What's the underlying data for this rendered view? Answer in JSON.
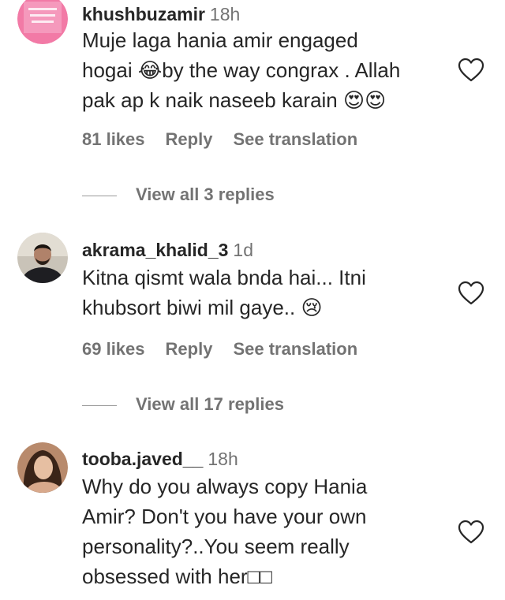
{
  "comments": [
    {
      "username": "khushbuzamir",
      "time": "18h",
      "lines": [
        "Muje laga hania amir engaged",
        "hogai 😂by the way congrax . Allah",
        "pak ap k naik naseeb karain 😍😍"
      ],
      "likes": "81 likes",
      "reply_label": "Reply",
      "translate_label": "See translation",
      "view_replies": "View all 3 replies",
      "avatar": "pink-avatar"
    },
    {
      "username": "akrama_khalid_3",
      "time": "1d",
      "lines": [
        "Kitna qismt wala bnda hai... Itni",
        "khubsort biwi mil gaye.. 😢"
      ],
      "likes": "69 likes",
      "reply_label": "Reply",
      "translate_label": "See translation",
      "view_replies": "View all 17 replies",
      "avatar": "man-avatar"
    },
    {
      "username": "tooba.javed__",
      "time": "18h",
      "lines": [
        "Why do you always copy Hania",
        "Amir? Don't you have your own",
        "personality?..You seem really",
        "obsessed with her□□"
      ],
      "avatar": "woman-avatar"
    }
  ],
  "icons": {
    "like": "heart-outline-icon"
  },
  "colors": {
    "text": "#262626",
    "secondary": "#737373",
    "avatar_pink": "#f27aa6"
  }
}
